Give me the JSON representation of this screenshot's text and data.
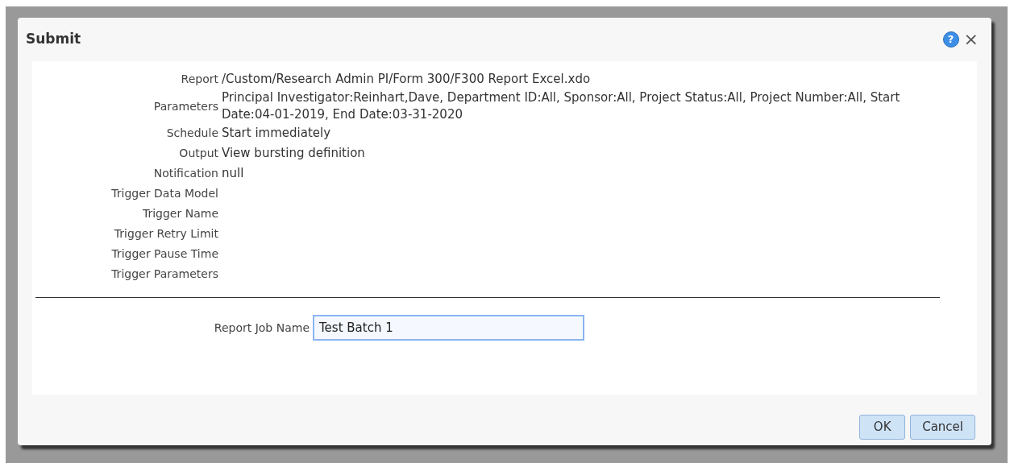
{
  "dialog": {
    "title": "Submit",
    "help_icon": "?",
    "close_icon": "×"
  },
  "details": [
    {
      "label": "Report",
      "value": "/Custom/Research Admin PI/Form 300/F300 Report Excel.xdo"
    },
    {
      "label": "Parameters",
      "value": "Principal Investigator:Reinhart,Dave, Department ID:All, Sponsor:All, Project Status:All, Project Number:All, Start Date:04-01-2019, End Date:03-31-2020"
    },
    {
      "label": "Schedule",
      "value": "Start immediately"
    },
    {
      "label": "Output",
      "value": "View bursting definition"
    },
    {
      "label": "Notification",
      "value": "null"
    },
    {
      "label": "Trigger Data Model"
    },
    {
      "label": "Trigger Name"
    },
    {
      "label": "Trigger Retry Limit"
    },
    {
      "label": "Trigger Pause Time"
    },
    {
      "label": "Trigger Parameters"
    }
  ],
  "job_name": {
    "label": "Report Job Name",
    "value": "Test Batch 1",
    "focused": true
  },
  "buttons": [
    "OK",
    "Cancel"
  ]
}
